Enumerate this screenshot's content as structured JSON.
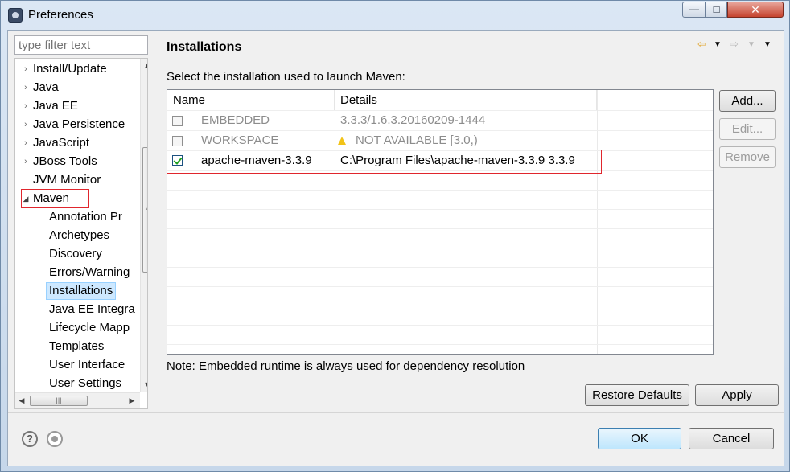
{
  "window": {
    "title": "Preferences"
  },
  "tree": {
    "filter_placeholder": "type filter text",
    "items": [
      {
        "label": "Install/Update",
        "twisty": "›"
      },
      {
        "label": "Java",
        "twisty": "›"
      },
      {
        "label": "Java EE",
        "twisty": "›"
      },
      {
        "label": "Java Persistence",
        "twisty": "›"
      },
      {
        "label": "JavaScript",
        "twisty": "›"
      },
      {
        "label": "JBoss Tools",
        "twisty": "›"
      },
      {
        "label": "JVM Monitor",
        "twisty": ""
      },
      {
        "label": "Maven",
        "twisty": "◢"
      }
    ],
    "children": [
      "Annotation Pr",
      "Archetypes",
      "Discovery",
      "Errors/Warning",
      "Installations",
      "Java EE Integra",
      "Lifecycle Mapp",
      "Templates",
      "User Interface",
      "User Settings"
    ],
    "selected": "Installations"
  },
  "page": {
    "title": "Installations",
    "subtitle": "Select the installation used to launch Maven:",
    "columns": [
      "Name",
      "Details"
    ],
    "rows": [
      {
        "name": "EMBEDDED",
        "details": "3.3.3/1.6.3.20160209-1444",
        "checked": false,
        "enabled": false,
        "warning": false
      },
      {
        "name": "WORKSPACE",
        "details": "NOT AVAILABLE [3.0,)",
        "checked": false,
        "enabled": false,
        "warning": true
      },
      {
        "name": "apache-maven-3.3.9",
        "details": "C:\\Program Files\\apache-maven-3.3.9 3.3.9",
        "checked": true,
        "enabled": true,
        "warning": false
      }
    ],
    "buttons": {
      "add": "Add...",
      "edit": "Edit...",
      "remove": "Remove"
    },
    "note": "Note: Embedded runtime is always used for dependency resolution",
    "restore_defaults": "Restore Defaults",
    "apply": "Apply"
  },
  "dialog": {
    "ok": "OK",
    "cancel": "Cancel"
  },
  "colors": {
    "highlight": "#e0262d",
    "selection": "#cde8ff",
    "warning": "#f2c318"
  }
}
